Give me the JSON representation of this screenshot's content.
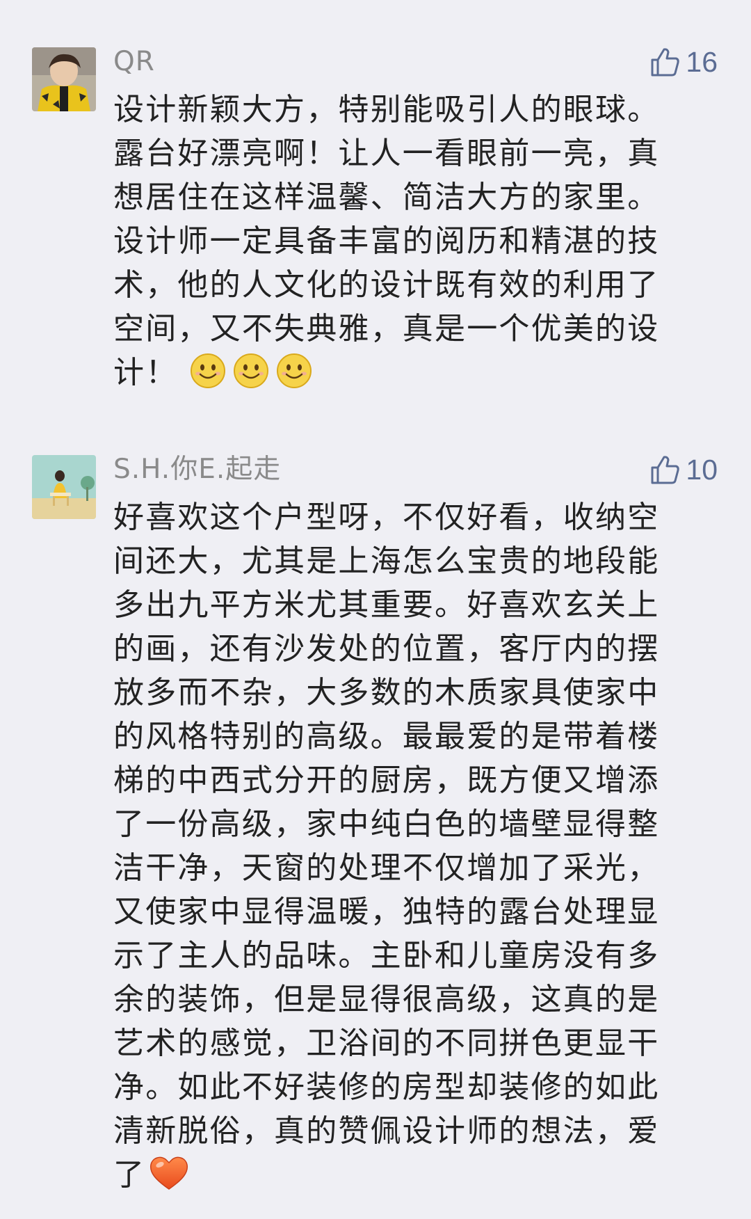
{
  "comments": [
    {
      "username": "QR",
      "likes": "16",
      "avatar": "avatar-boy-yellow-jacket",
      "text": "设计新颖大方，特别能吸引人的眼球。露台好漂亮啊！让人一看眼前一亮，真想居住在这样温馨、简洁大方的家里。设计师一定具备丰富的阅历和精湛的技术，他的人文化的设计既有效的利用了空间，又不失典雅，真是一个优美的设计！",
      "trailing_icons": [
        "smile-emoji",
        "smile-emoji",
        "smile-emoji"
      ]
    },
    {
      "username": "S.H.你E.起走",
      "likes": "10",
      "avatar": "avatar-girl-pastel-scene",
      "text": "好喜欢这个户型呀，不仅好看，收纳空间还大，尤其是上海怎么宝贵的地段能多出九平方米尤其重要。好喜欢玄关上的画，还有沙发处的位置，客厅内的摆放多而不杂，大多数的木质家具使家中的风格特别的高级。最最爱的是带着楼梯的中西式分开的厨房，既方便又增添了一份高级，家中纯白色的墙壁显得整洁干净，天窗的处理不仅增加了采光，又使家中显得温暖，独特的露台处理显示了主人的品味。主卧和儿童房没有多余的装饰，但是显得很高级，这真的是艺术的感觉，卫浴间的不同拼色更显干净。如此不好装修的房型却装修的如此清新脱俗，真的赞佩设计师的想法，爱了",
      "trailing_icons": [
        "heart-emoji"
      ]
    }
  ],
  "colors": {
    "background": "#efeff4",
    "username": "#8a8a8a",
    "like_accent": "#5b6c93",
    "text": "#222222"
  }
}
